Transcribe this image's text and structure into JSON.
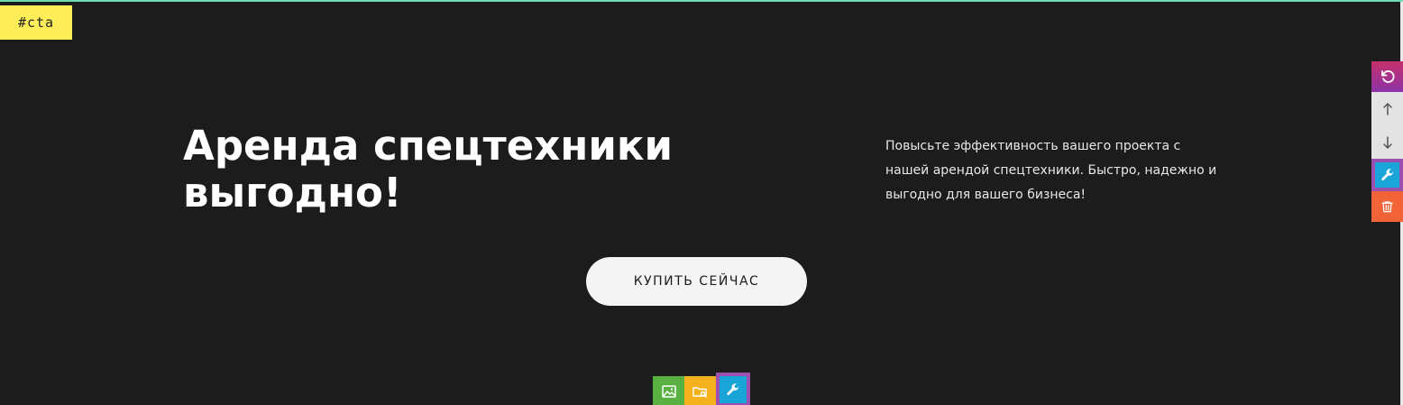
{
  "section": {
    "tag": "#cta"
  },
  "hero": {
    "title_line1": "Аренда спецтехники",
    "title_line2": "выгодно!",
    "description_line1": "Повысьте эффективность вашего проекта с",
    "description_line2": "нашей арендой спецтехники. Быстро, надежно и",
    "description_line3": "выгодно для вашего бизнеса!",
    "cta_label": "КУПИТЬ СЕЙЧАС"
  },
  "side_toolbar": {
    "items": [
      {
        "icon": "reset-icon",
        "color": "#c5316b"
      },
      {
        "icon": "arrow-up-icon",
        "color": "#e3e3e3"
      },
      {
        "icon": "arrow-down-icon",
        "color": "#e3e3e3"
      },
      {
        "icon": "wrench-icon",
        "color": "#19a5d8"
      },
      {
        "icon": "trash-icon",
        "color": "#f26437"
      }
    ]
  },
  "bottom_toolbar": {
    "items": [
      {
        "icon": "image-icon",
        "color": "#57b040"
      },
      {
        "icon": "folder-search-icon",
        "color": "#f2b11d"
      },
      {
        "icon": "wrench-icon",
        "color": "#19a5d8"
      }
    ]
  },
  "colors": {
    "background": "#1c1c1c",
    "tag": "#ffee58",
    "selection_outline": "#9b4fb0",
    "top_border": "#6fd9b0"
  }
}
